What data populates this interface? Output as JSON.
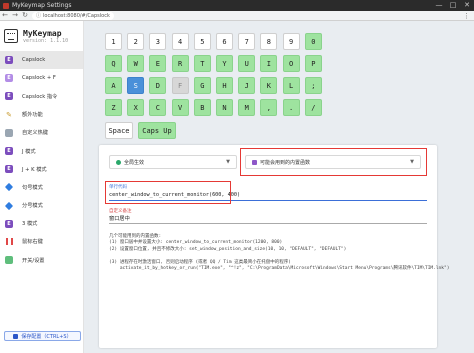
{
  "window": {
    "title": "MyKeymap Settings",
    "minimize": "—",
    "maximize": "□",
    "close": "✕"
  },
  "browser": {
    "url": "localhost:8080/#/Capslock",
    "back": "←",
    "forward": "→",
    "reload": "↻",
    "menu": "⋮"
  },
  "brand": {
    "name": "MyKeymap",
    "version": "version: 1.1.10"
  },
  "sidebar": {
    "items": [
      {
        "label": "Capslock",
        "icon": "e-icon",
        "active": true
      },
      {
        "label": "Capslock + F",
        "icon": "e-icon"
      },
      {
        "label": "Capslock 指令",
        "icon": "e-icon"
      },
      {
        "label": "额外功能",
        "icon": "pencil-icon"
      },
      {
        "label": "自定义热键",
        "icon": "doc-icon"
      },
      {
        "label": "J 模式",
        "icon": "e-icon"
      },
      {
        "label": "J + K 模式",
        "icon": "e-icon"
      },
      {
        "label": "句号模式",
        "icon": "diamond-icon"
      },
      {
        "label": "分号模式",
        "icon": "diamond-icon"
      },
      {
        "label": "3 模式",
        "icon": "e-icon"
      },
      {
        "label": "鼠标右键",
        "icon": "bars-icon"
      },
      {
        "label": "开关/设置",
        "icon": "cube-icon"
      }
    ],
    "save_label": "保存配置（CTRL+S）"
  },
  "keyboard": {
    "rows": [
      [
        {
          "label": "1",
          "state": "normal"
        },
        {
          "label": "2",
          "state": "normal"
        },
        {
          "label": "3",
          "state": "normal"
        },
        {
          "label": "4",
          "state": "normal"
        },
        {
          "label": "5",
          "state": "normal"
        },
        {
          "label": "6",
          "state": "normal"
        },
        {
          "label": "7",
          "state": "normal"
        },
        {
          "label": "8",
          "state": "normal"
        },
        {
          "label": "9",
          "state": "normal"
        },
        {
          "label": "0",
          "state": "green"
        }
      ],
      [
        {
          "label": "Q",
          "state": "green"
        },
        {
          "label": "W",
          "state": "green"
        },
        {
          "label": "E",
          "state": "green"
        },
        {
          "label": "R",
          "state": "green"
        },
        {
          "label": "T",
          "state": "green"
        },
        {
          "label": "Y",
          "state": "green"
        },
        {
          "label": "U",
          "state": "green"
        },
        {
          "label": "I",
          "state": "green"
        },
        {
          "label": "O",
          "state": "green"
        },
        {
          "label": "P",
          "state": "green"
        }
      ],
      [
        {
          "label": "A",
          "state": "green"
        },
        {
          "label": "S",
          "state": "blue"
        },
        {
          "label": "D",
          "state": "green"
        },
        {
          "label": "F",
          "state": "gray"
        },
        {
          "label": "G",
          "state": "green"
        },
        {
          "label": "H",
          "state": "green"
        },
        {
          "label": "J",
          "state": "green"
        },
        {
          "label": "K",
          "state": "green"
        },
        {
          "label": "L",
          "state": "green"
        },
        {
          "label": ";",
          "state": "green"
        }
      ],
      [
        {
          "label": "Z",
          "state": "green"
        },
        {
          "label": "X",
          "state": "green"
        },
        {
          "label": "C",
          "state": "green"
        },
        {
          "label": "V",
          "state": "green"
        },
        {
          "label": "B",
          "state": "green"
        },
        {
          "label": "N",
          "state": "green"
        },
        {
          "label": "M",
          "state": "green"
        },
        {
          "label": ",",
          "state": "green"
        },
        {
          "label": ".",
          "state": "green"
        },
        {
          "label": "/",
          "state": "green"
        }
      ],
      [
        {
          "label": "Space",
          "state": "normal"
        },
        {
          "label": "Caps Up",
          "state": "green"
        }
      ]
    ]
  },
  "panel": {
    "scope_select": "全局生效",
    "builtin_select": "可能会用到的内置函数",
    "code_label": "单行代码",
    "code_value": "center_window_to_current_monitor(600, 400)",
    "desc_label": "自定义备注",
    "desc_value": "窗口居中",
    "help_lines": [
      "几个可能用到的内置函数:",
      "(1) 窗口居中并设置大小: center_window_to_current_monitor(1200, 800)",
      "(2) 设置窗口位置, 并且不修改大小: set_window_position_and_size(10, 10, \"DEFAULT\", \"DEFAULT\")",
      "",
      "(3) 进程存在时激活窗口, 否则启动程序 (或者 QQ / Tim 这类最简小在托盘中的程序)",
      "    activate_it_by_hotkey_or_run(\"TIM.exe\", \"^!z\", \"C:\\ProgramData\\Microsoft\\Windows\\Start Menu\\Programs\\腾讯软件\\TIM\\TIM.lnk\")"
    ]
  },
  "colors": {
    "accent": "#3b6fd8",
    "key_green": "#9ee39f",
    "key_blue": "#4a90d9",
    "highlight_red": "#e53935"
  }
}
